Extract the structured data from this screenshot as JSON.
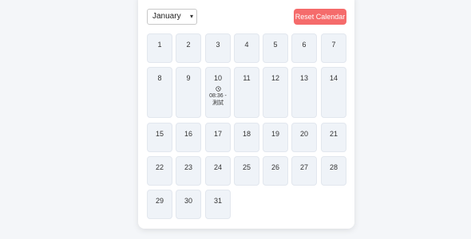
{
  "month_select": {
    "value": "January"
  },
  "reset_button": {
    "label": "Reset Calendar"
  },
  "days": [
    {
      "num": "1"
    },
    {
      "num": "2"
    },
    {
      "num": "3"
    },
    {
      "num": "4"
    },
    {
      "num": "5"
    },
    {
      "num": "6"
    },
    {
      "num": "7"
    },
    {
      "num": "8"
    },
    {
      "num": "9"
    },
    {
      "num": "10",
      "event": {
        "icon": "clock-icon",
        "text": "08:36 - 測試"
      }
    },
    {
      "num": "11"
    },
    {
      "num": "12"
    },
    {
      "num": "13"
    },
    {
      "num": "14"
    },
    {
      "num": "15"
    },
    {
      "num": "16"
    },
    {
      "num": "17"
    },
    {
      "num": "18"
    },
    {
      "num": "19"
    },
    {
      "num": "20"
    },
    {
      "num": "21"
    },
    {
      "num": "22"
    },
    {
      "num": "23"
    },
    {
      "num": "24"
    },
    {
      "num": "25"
    },
    {
      "num": "26"
    },
    {
      "num": "27"
    },
    {
      "num": "28"
    },
    {
      "num": "29"
    },
    {
      "num": "30"
    },
    {
      "num": "31"
    }
  ],
  "colors": {
    "accent": "#f56b6b",
    "day_bg": "#eff3f8",
    "page_bg": "#f4f6f9"
  }
}
